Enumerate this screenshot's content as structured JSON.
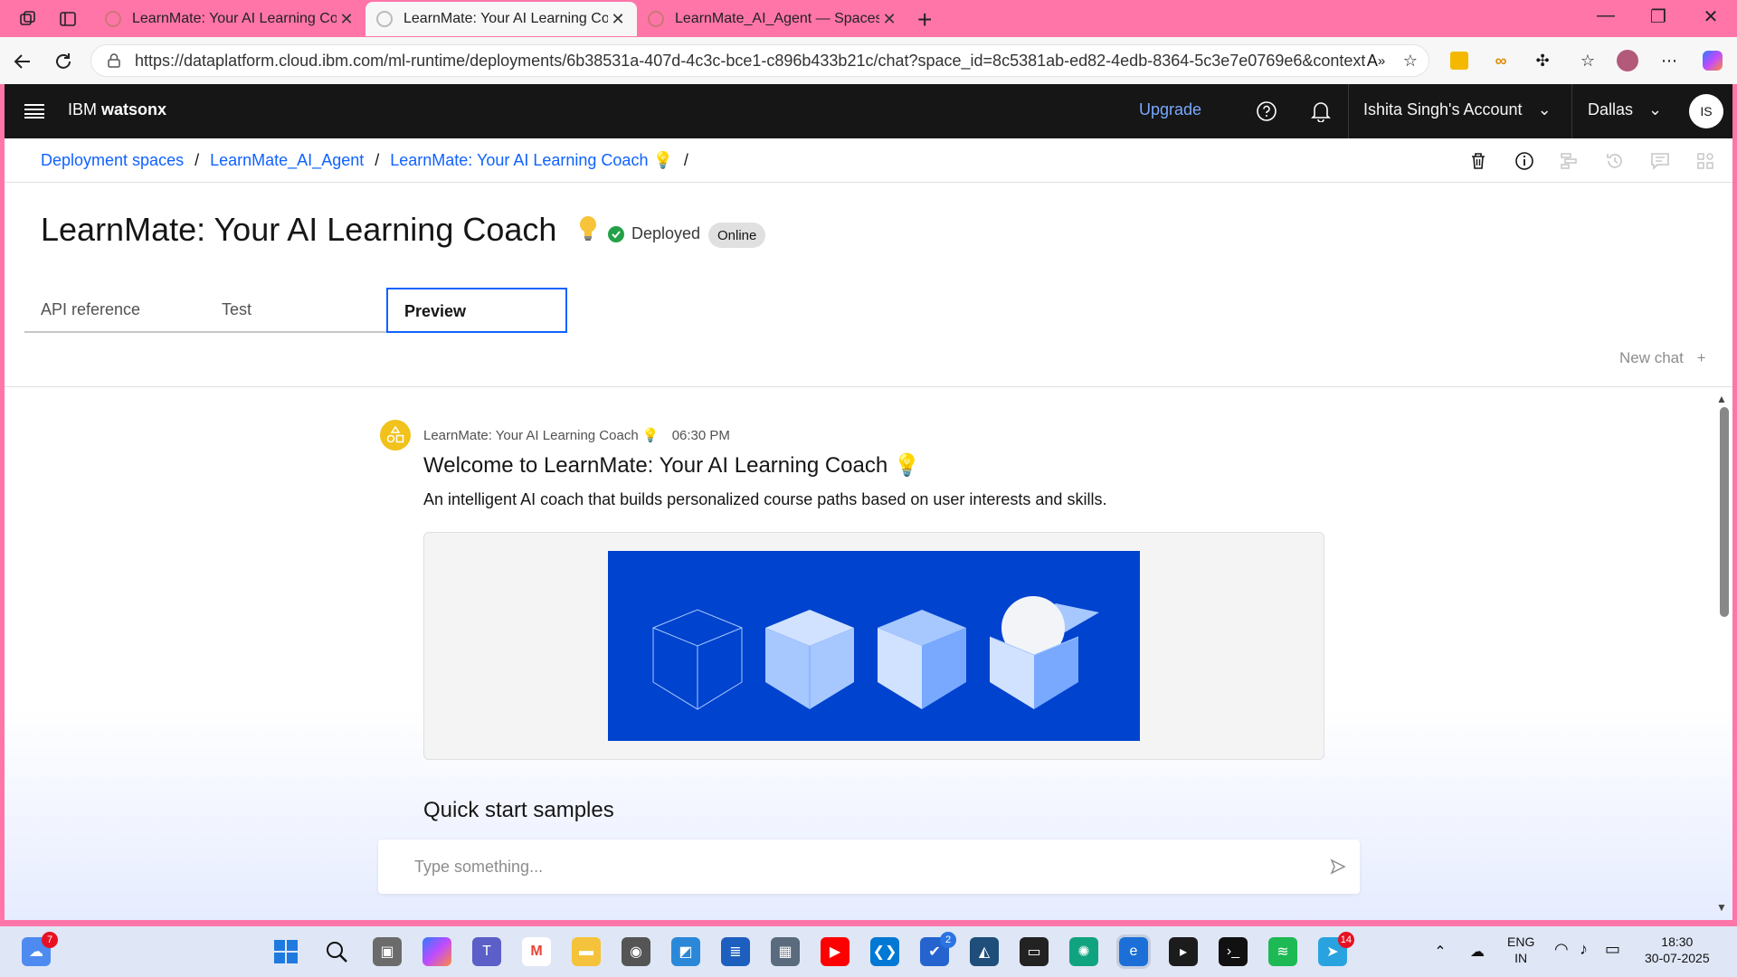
{
  "browser": {
    "tabs": [
      {
        "title": "LearnMate: Your AI Learning Coach",
        "active": false
      },
      {
        "title": "LearnMate: Your AI Learning Coach",
        "active": true
      },
      {
        "title": "LearnMate_AI_Agent — Spaces | IBM",
        "active": false
      }
    ],
    "url": "https://dataplatform.cloud.ibm.com/ml-runtime/deployments/6b38531a-407d-4c3c-bce1-c896b433b21c/chat?space_id=8c5381ab-ed82-4edb-8364-5c3e7e0769e6&context..."
  },
  "topnav": {
    "brand_prefix": "IBM",
    "brand_name": "watsonx",
    "upgrade": "Upgrade",
    "account": "Ishita Singh's Account",
    "region": "Dallas",
    "avatar_initials": "IS"
  },
  "breadcrumb": [
    "Deployment spaces",
    "LearnMate_AI_Agent",
    "LearnMate: Your AI Learning Coach 💡"
  ],
  "header": {
    "title": "LearnMate: Your AI Learning Coach",
    "status": "Deployed",
    "tag": "Online"
  },
  "tabs": [
    "API reference",
    "Test",
    "Preview"
  ],
  "new_chat": "New chat",
  "chat": {
    "sender": "LearnMate: Your AI Learning Coach 💡",
    "time": "06:30 PM",
    "welcome": "Welcome to LearnMate: Your AI Learning Coach 💡",
    "description": "An intelligent AI coach that builds personalized course paths based on user interests and skills.",
    "quick_start": "Quick start samples",
    "input_placeholder": "Type something..."
  },
  "taskbar": {
    "weather_badge": "7",
    "todo_badge": "2",
    "telegram_badge": "14",
    "lang_line1": "ENG",
    "lang_line2": "IN",
    "time": "18:30",
    "date": "30-07-2025"
  },
  "colors": {
    "accent": "#0f62fe",
    "chrome": "#ff75a8",
    "nav": "#161616",
    "art_bg": "#0043ce"
  }
}
